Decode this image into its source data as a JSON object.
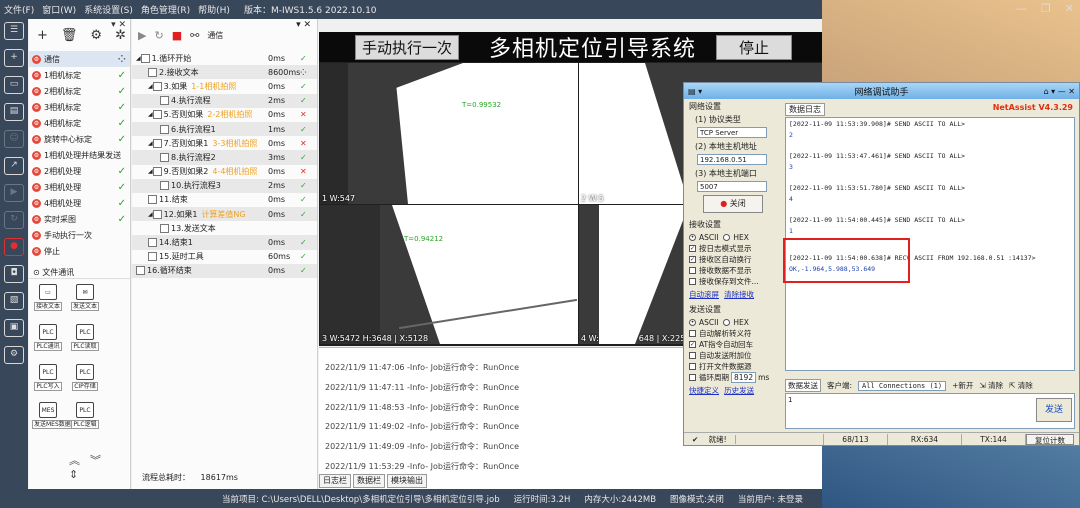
{
  "menu": [
    "文件(F)",
    "窗口(W)",
    "系统设置(S)",
    "角色管理(R)",
    "帮助(H)",
    "版本：M-IWS1.5.6 2022.10.10"
  ],
  "left_panel": {
    "items": [
      {
        "label": "通信",
        "check": false,
        "selected": true
      },
      {
        "label": "1相机标定",
        "check": true
      },
      {
        "label": "2相机标定",
        "check": true
      },
      {
        "label": "3相机标定",
        "check": true
      },
      {
        "label": "4相机标定",
        "check": true
      },
      {
        "label": "旋转中心标定",
        "check": true
      },
      {
        "label": "1相机处理并结果发送",
        "check": false
      },
      {
        "label": "2相机处理",
        "check": true
      },
      {
        "label": "3相机处理",
        "check": true
      },
      {
        "label": "4相机处理",
        "check": true
      },
      {
        "label": "实时采图",
        "check": true
      },
      {
        "label": "手动执行一次",
        "check": false
      },
      {
        "label": "停止",
        "check": false
      }
    ],
    "section": "文件通讯",
    "tools": [
      "接收文本",
      "发送文本",
      "PLC通讯",
      "PLC读取",
      "PLC写入",
      "CIP存储",
      "发送MES数据",
      "PLC逻辑"
    ]
  },
  "flow_panel": {
    "toolbar_label": "通信",
    "rows": [
      {
        "name": "1.循环开始",
        "comment": "",
        "time": "0ms",
        "status": "ok",
        "indent": 0
      },
      {
        "name": "2.接收文本",
        "comment": "",
        "time": "8600ms",
        "status": "spin",
        "indent": 1
      },
      {
        "name": "3.如果",
        "comment": "1-1相机拍照",
        "time": "0ms",
        "status": "ok",
        "indent": 1
      },
      {
        "name": "4.执行流程",
        "comment": "",
        "time": "2ms",
        "status": "ok",
        "indent": 2
      },
      {
        "name": "5.否则如果",
        "comment": "2-2相机拍照",
        "time": "0ms",
        "status": "bad",
        "indent": 1
      },
      {
        "name": "6.执行流程1",
        "comment": "",
        "time": "1ms",
        "status": "ok",
        "indent": 2
      },
      {
        "name": "7.否则如果1",
        "comment": "3-3相机拍照",
        "time": "0ms",
        "status": "bad",
        "indent": 1
      },
      {
        "name": "8.执行流程2",
        "comment": "",
        "time": "3ms",
        "status": "ok",
        "indent": 2
      },
      {
        "name": "9.否则如果2",
        "comment": "4-4相机拍照",
        "time": "0ms",
        "status": "bad",
        "indent": 1
      },
      {
        "name": "10.执行流程3",
        "comment": "",
        "time": "2ms",
        "status": "ok",
        "indent": 2
      },
      {
        "name": "11.结束",
        "comment": "",
        "time": "0ms",
        "status": "ok",
        "indent": 1
      },
      {
        "name": "12.如果1",
        "comment": "计算差值NG",
        "time": "0ms",
        "status": "ok",
        "indent": 1
      },
      {
        "name": "13.发送文本",
        "comment": "",
        "time": "",
        "status": "",
        "indent": 2
      },
      {
        "name": "14.结束1",
        "comment": "",
        "time": "0ms",
        "status": "ok",
        "indent": 1
      },
      {
        "name": "15.延时工具",
        "comment": "",
        "time": "60ms",
        "status": "ok",
        "indent": 1
      },
      {
        "name": "16.循环结束",
        "comment": "",
        "time": "0ms",
        "status": "ok",
        "indent": 0
      }
    ],
    "total_label": "流程总耗时：",
    "total_value": "18617ms"
  },
  "vision": {
    "manual_btn": "手动执行一次",
    "system_name": "多相机定位引导系统",
    "stop_btn": "停止",
    "cam1_score": "0.99532",
    "cam1_label": "1 W:547",
    "cam2_label": "2 W:5",
    "cam3_score": "0.94212",
    "cam3_label": "3 W:5472 H:3648 | X:5128",
    "cam4_label": "4 W:",
    "cam4_tail": "648 | X:2252 Y:"
  },
  "log": {
    "lines": [
      "2022/11/9 11:47:06 -Info- Job运行命令：RunOnce",
      "2022/11/9 11:47:11 -Info- Job运行命令：RunOnce",
      "2022/11/9 11:48:53 -Info- Job运行命令：RunOnce",
      "2022/11/9 11:49:02 -Info- Job运行命令：RunOnce",
      "2022/11/9 11:49:09 -Info- Job运行命令：RunOnce",
      "2022/11/9 11:53:29 -Info- Job运行命令：RunOnce"
    ],
    "tabs": [
      "日志栏",
      "数据栏",
      "模块输出"
    ]
  },
  "statusbar": {
    "project": "当前项目: C:\\Users\\DELL\\Desktop\\多相机定位引导\\多相机定位引导.job",
    "runtime": "运行时间:3.2H",
    "memory": "内存大小:2442MB",
    "image_mode": "图像模式:关闭",
    "user": "当前用户:",
    "user_value": "未登录"
  },
  "netassist": {
    "title": "网络调试助手",
    "brand": "NetAssist V4.3.29",
    "net_settings": "网络设置",
    "proto_label": "(1) 协议类型",
    "proto_value": "TCP Server",
    "host_label": "(2) 本地主机地址",
    "host_value": "192.168.0.51",
    "port_label": "(3) 本地主机端口",
    "port_value": "5007",
    "close_btn": "关闭",
    "recv_settings": "接收设置",
    "ascii": "ASCII",
    "hex": "HEX",
    "recv_opts": [
      "按日志模式显示",
      "接收区自动换行",
      "接收数据不显示",
      "接收保存到文件..."
    ],
    "recv_links": [
      "自动滚屏",
      "清除接收"
    ],
    "send_settings": "发送设置",
    "send_opts": [
      "自动解析转义符",
      "AT指令自动回车",
      "自动发送附加位",
      "打开文件数据源",
      "循环周期"
    ],
    "cycle_value": "8192",
    "cycle_unit": "ms",
    "send_links": [
      "快捷定义",
      "历史发送"
    ],
    "log_tab": "数据日志",
    "recv_lines": [
      {
        "head": "[2022-11-09 11:53:39.908]# SEND ASCII TO ALL>",
        "val": "2"
      },
      {
        "head": "[2022-11-09 11:53:47.461]# SEND ASCII TO ALL>",
        "val": "3"
      },
      {
        "head": "[2022-11-09 11:53:51.780]# SEND ASCII TO ALL>",
        "val": "4"
      },
      {
        "head": "[2022-11-09 11:54:00.445]# SEND ASCII TO ALL>",
        "val": "1"
      },
      {
        "head": "[2022-11-09 11:54:00.638]# RECV ASCII FROM 192.168.0.51 :14137>",
        "val": "OK,-1.964,5.988,53.649"
      }
    ],
    "send_tab": "数据发送",
    "client_label": "客户端:",
    "client_value": "All Connections (1)",
    "new_line": "+新开",
    "clear1": "清除",
    "clear2": "清除",
    "send_value": "1",
    "send_btn": "发送",
    "status_ready": "就绪!",
    "status_count": "68/113",
    "rx": "RX:634",
    "tx": "TX:144",
    "reset": "复位计数"
  }
}
